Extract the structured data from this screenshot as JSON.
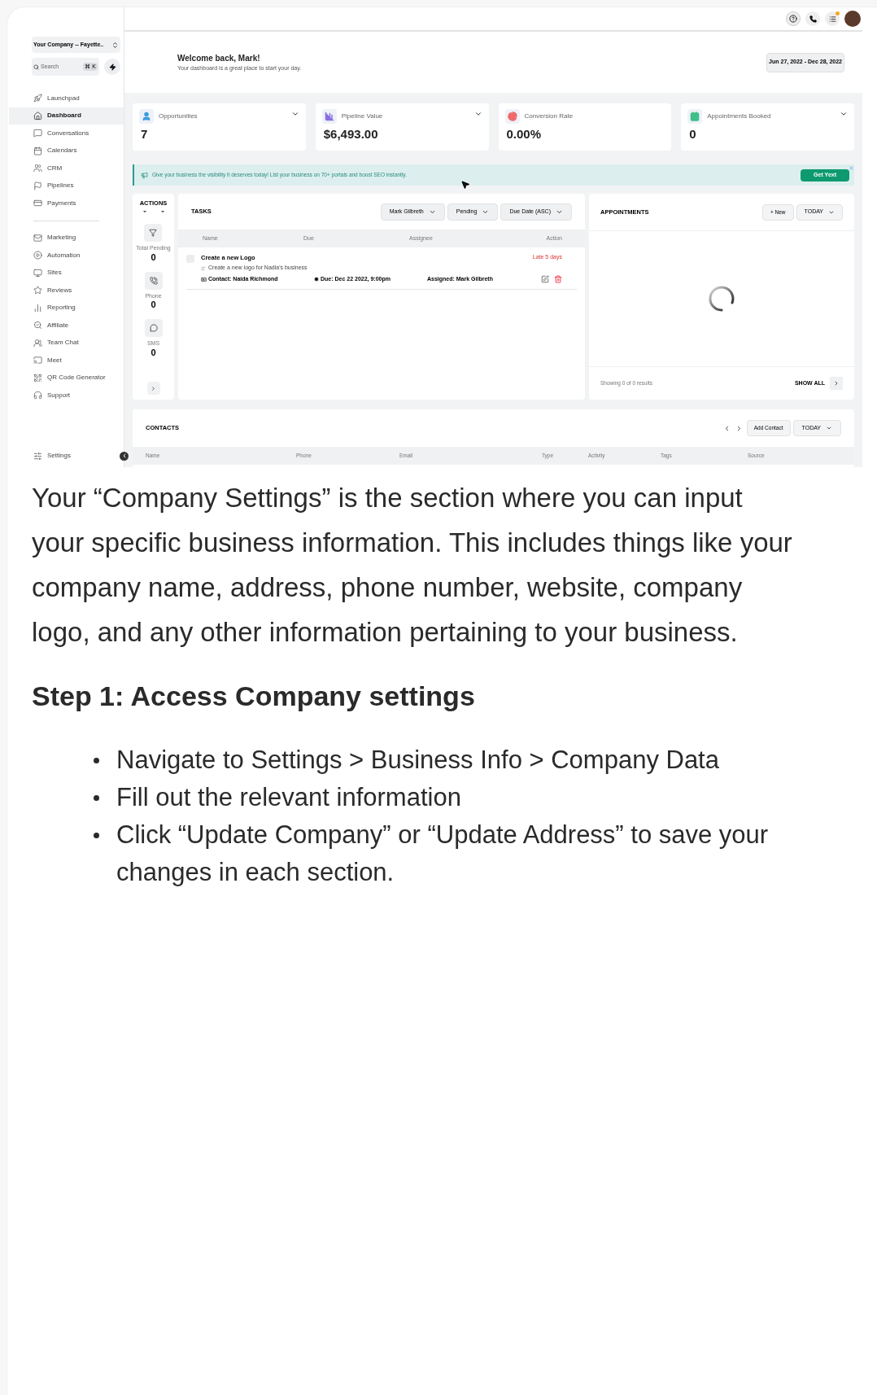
{
  "sidebar": {
    "account": "Your Company -- Fayette..",
    "search": {
      "placeholder": "Search",
      "shortcut": "⌘ K"
    },
    "items": [
      {
        "label": "Launchpad",
        "selected": false
      },
      {
        "label": "Dashboard",
        "selected": true
      },
      {
        "label": "Conversations",
        "selected": false
      },
      {
        "label": "Calendars",
        "selected": false
      },
      {
        "label": "CRM",
        "selected": false
      },
      {
        "label": "Pipelines",
        "selected": false
      },
      {
        "label": "Payments",
        "selected": false
      }
    ],
    "items_2": [
      {
        "label": "Marketing",
        "selected": false
      },
      {
        "label": "Automation",
        "selected": false
      },
      {
        "label": "Sites",
        "selected": false
      },
      {
        "label": "Reviews",
        "selected": false
      },
      {
        "label": "Reporting",
        "selected": false
      },
      {
        "label": "Affiliate",
        "selected": false
      },
      {
        "label": "Team Chat",
        "selected": false
      },
      {
        "label": "Meet",
        "selected": false
      },
      {
        "label": "QR Code Generator",
        "selected": false
      },
      {
        "label": "Support",
        "selected": false
      }
    ],
    "settings": "Settings"
  },
  "header": {
    "title": "Welcome back, Mark!",
    "subtitle": "Your dashboard is a great place to start your day.",
    "date_range": "Jun 27, 2022 - Dec 28, 2022"
  },
  "stats": [
    {
      "label": "Opportunities",
      "value": "7",
      "color": "#3b9be0",
      "dropdown": true
    },
    {
      "label": "Pipeline Value",
      "value": "$6,493.00",
      "color": "#8b6fe0",
      "dropdown": true
    },
    {
      "label": "Conversion Rate",
      "value": "0.00%",
      "color": "#ef6a6a",
      "dropdown": false
    },
    {
      "label": "Appointments Booked",
      "value": "0",
      "color": "#3fbf8a",
      "dropdown": true
    }
  ],
  "banner": {
    "text": "Give your business the visibility it deserves today! List your business on 70+ portals and boost SEO instantly.",
    "button": "Get Yext"
  },
  "actions": {
    "title": "ACTIONS",
    "counters": [
      {
        "label": "Total Pending",
        "value": "0"
      },
      {
        "label": "Phone",
        "value": "0"
      },
      {
        "label": "SMS",
        "value": "0"
      }
    ]
  },
  "tasks": {
    "title": "TASKS",
    "filters": [
      "Mark Gilbreth",
      "Pending",
      "Due Date (ASC)"
    ],
    "columns": [
      "Name",
      "Due",
      "Assignee",
      "Action"
    ],
    "rows": [
      {
        "title": "Create a new Logo",
        "description": "Create a new logo for Nadia's business",
        "contact": "Contact: Naida Richmond",
        "due": "Due: Dec 22 2022, 9:00pm",
        "assigned": "Assigned: Mark Gilbreth",
        "status": "Late 5 days",
        "checked": false
      }
    ]
  },
  "appointments": {
    "title": "APPOINTMENTS",
    "new_button": "+ New",
    "range": "TODAY",
    "footer": "Showing 0 of 0 results",
    "show_all": "SHOW ALL"
  },
  "contacts": {
    "title": "CONTACTS",
    "add_button": "Add Contact",
    "range": "TODAY",
    "columns": [
      "Name",
      "Phone",
      "Email",
      "Type",
      "Activity",
      "Tags",
      "Source"
    ]
  },
  "article": {
    "intro": "Your “Company Settings” is the section where you can input your specific business information. This includes things like your company name, address, phone number, website, company logo, and any other information pertaining to your business.",
    "heading": "Step 1: Access Company settings",
    "steps": [
      "Navigate to Settings > Business Info > Company Data",
      "Fill out the relevant information",
      "Click “Update Company” or “Update Address” to save your changes in each section."
    ]
  }
}
